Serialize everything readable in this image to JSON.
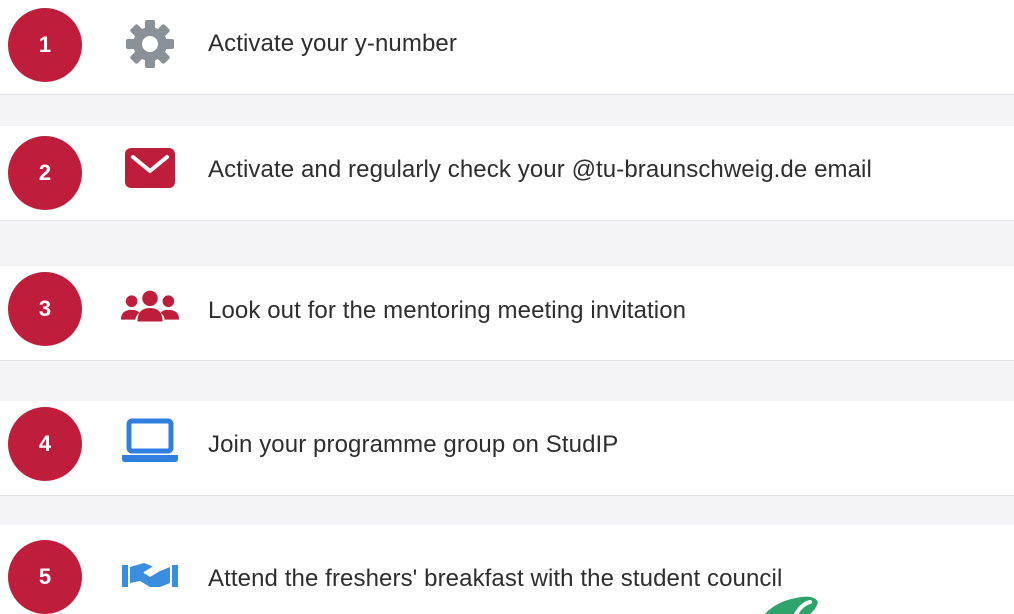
{
  "steps": [
    {
      "number": "1",
      "icon": "gear-icon",
      "text": "Activate your y-number"
    },
    {
      "number": "2",
      "icon": "mail-icon",
      "text": "Activate and regularly check your @tu-braunschweig.de email"
    },
    {
      "number": "3",
      "icon": "users-icon",
      "text": "Look out for the mentoring meeting invitation"
    },
    {
      "number": "4",
      "icon": "laptop-icon",
      "text": "Join your programme group on StudIP"
    },
    {
      "number": "5",
      "icon": "handshake-icon",
      "text": "Attend the freshers' breakfast with the student council"
    }
  ],
  "colors": {
    "accent": "#be1e3c",
    "gear": "#8a9199",
    "laptop": "#2f7ee0",
    "handshake": "#3b8de0",
    "leaf": "#2fa36b"
  }
}
